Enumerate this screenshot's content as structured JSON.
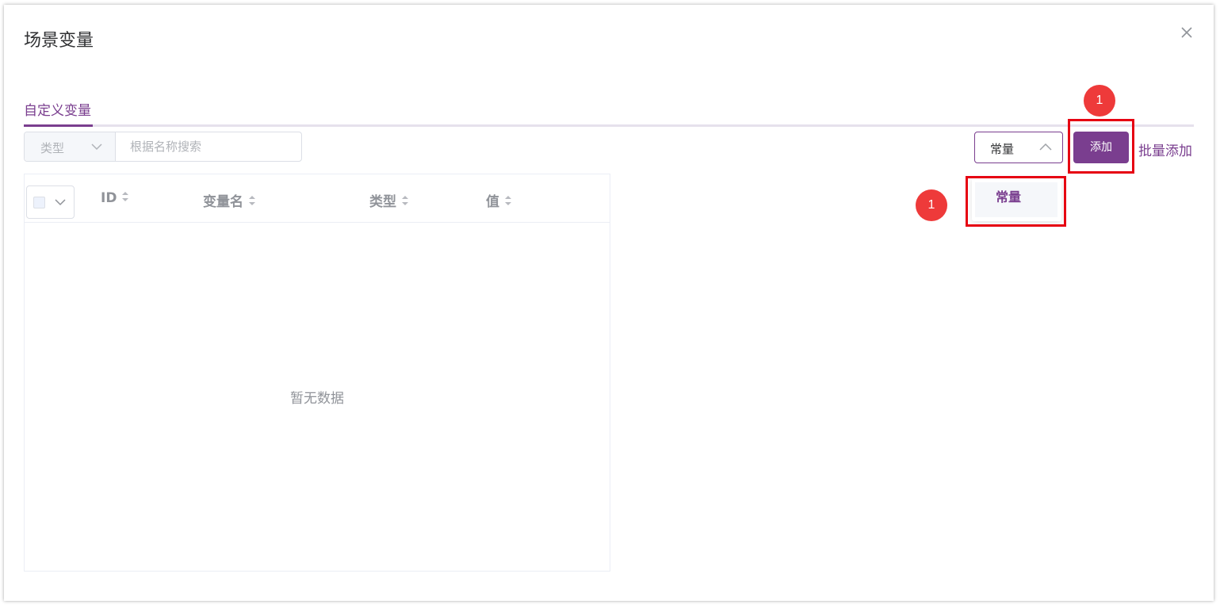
{
  "dialog": {
    "title": "场景变量"
  },
  "tabs": [
    {
      "label": "自定义变量",
      "active": true
    }
  ],
  "filter": {
    "type_placeholder": "类型",
    "search_placeholder": "根据名称搜索"
  },
  "toolbar": {
    "select_value": "常量",
    "add_label": "添加",
    "batch_add_label": "批量添加"
  },
  "dropdown": {
    "options": [
      {
        "label": "常量",
        "selected": true
      }
    ]
  },
  "annotations": {
    "step_marker_1": "1",
    "step_marker_2": "1"
  },
  "table": {
    "columns": [
      {
        "label": "ID",
        "sortable": true
      },
      {
        "label": "变量名",
        "sortable": true
      },
      {
        "label": "类型",
        "sortable": true
      },
      {
        "label": "值",
        "sortable": true
      }
    ],
    "rows": [],
    "empty_text": "暂无数据"
  },
  "colors": {
    "accent": "#7a3e8f",
    "highlight_box": "#e60012",
    "badge": "#ee3a3a",
    "muted_text": "#909399"
  }
}
